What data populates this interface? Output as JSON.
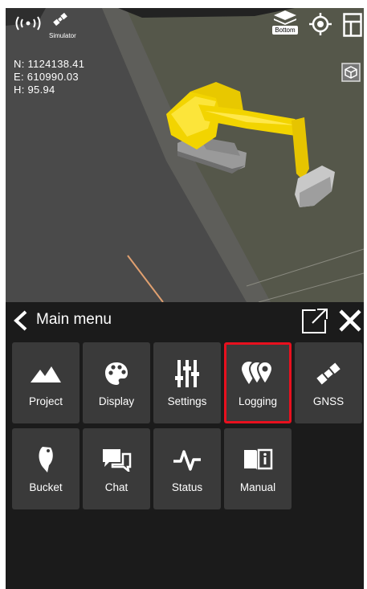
{
  "status": {
    "simulator_label": "Simulator",
    "layer_label": "Bottom"
  },
  "coordinates": {
    "north": "N: 1124138.41",
    "east": "E: 610990.03",
    "height": "H: 95.94"
  },
  "menu": {
    "title": "Main menu",
    "tiles": [
      {
        "label": "Project",
        "icon": "mountain-icon",
        "selected": false
      },
      {
        "label": "Display",
        "icon": "palette-icon",
        "selected": false
      },
      {
        "label": "Settings",
        "icon": "sliders-icon",
        "selected": false
      },
      {
        "label": "Logging",
        "icon": "location-pins-icon",
        "selected": true
      },
      {
        "label": "GNSS",
        "icon": "satellite-icon",
        "selected": false
      },
      {
        "label": "Bucket",
        "icon": "bucket-icon",
        "selected": false
      },
      {
        "label": "Chat",
        "icon": "chat-bubbles-icon",
        "selected": false
      },
      {
        "label": "Status",
        "icon": "pulse-icon",
        "selected": false
      },
      {
        "label": "Manual",
        "icon": "manual-book-icon",
        "selected": false
      }
    ]
  },
  "colors": {
    "selected_border": "#e8101e",
    "excavator": "#f5d800",
    "tile_background": "#3a3a3a"
  }
}
